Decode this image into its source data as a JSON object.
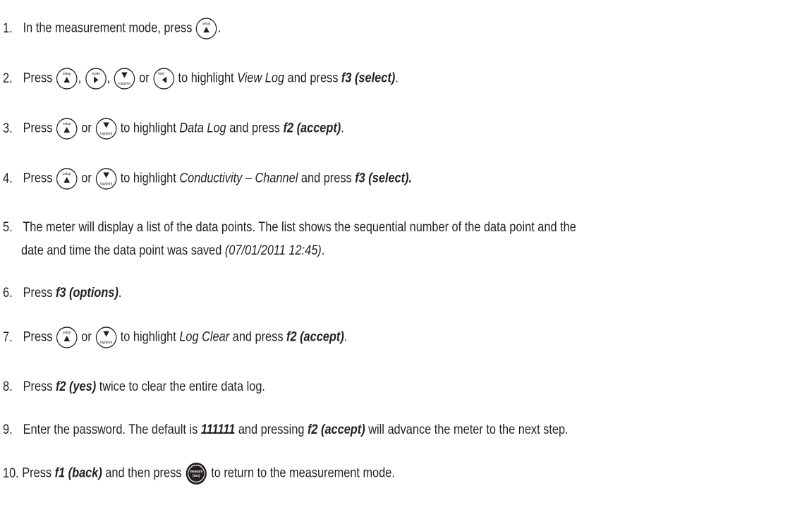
{
  "steps": [
    {
      "num": "1.",
      "t1": "In the measurement mode, press",
      "t2": "."
    },
    {
      "num": "2.",
      "t1": "Press",
      "sep1": ",",
      "sep2": ",",
      "sep3": "or",
      "t2": "to highlight",
      "hl": "View Log",
      "t3": "and press",
      "action": "f3 (select)",
      "t4": "."
    },
    {
      "num": "3.",
      "t1": "Press",
      "or": "or",
      "t2": "to highlight",
      "hl": "Data Log",
      "t3": "and press",
      "action": "f2 (accept)",
      "t4": "."
    },
    {
      "num": "4.",
      "t1": "Press",
      "or": "or",
      "t2": "to highlight",
      "hl": "Conductivity – Channel",
      "t3": "and press",
      "action": "f3 (select)."
    },
    {
      "num": "5.",
      "line1": "The meter will display a list of the data points. The list shows the sequential number of the data point and the",
      "line2a": "date and time the data point was saved",
      "line2b": "(07/01/2011 12:45)",
      "line2c": "."
    },
    {
      "num": "6.",
      "t1": "Press",
      "action": "f3 (options)",
      "t2": "."
    },
    {
      "num": "7.",
      "t1": "Press",
      "or": "or",
      "t2": "to highlight",
      "hl": "Log Clear",
      "t3": "and press",
      "action": "f2 (accept)",
      "t4": "."
    },
    {
      "num": "8.",
      "t1": "Press",
      "action": "f2 (yes)",
      "t2": "twice to clear the entire data log."
    },
    {
      "num": "9.",
      "t1": "Enter the password. The default is",
      "pw": "111111",
      "t2": "and pressing",
      "action": "f2 (accept)",
      "t3": "will advance the meter to the next step."
    },
    {
      "num": "10.",
      "t1": "Press",
      "action": "f1 (back)",
      "t2": "and then press",
      "t3": "to return to the measurement mode."
    }
  ],
  "keys": {
    "setup": {
      "label": "setup",
      "icon": "up-arrow-icon"
    },
    "mode": {
      "label": "mode",
      "icon": "right-arrow-icon"
    },
    "log": {
      "label": "log/print",
      "icon": "down-arrow-icon"
    },
    "hold": {
      "label": "hold",
      "icon": "left-arrow-icon"
    },
    "measure": {
      "label_top": "measure",
      "label_bottom": "(esc)"
    }
  }
}
